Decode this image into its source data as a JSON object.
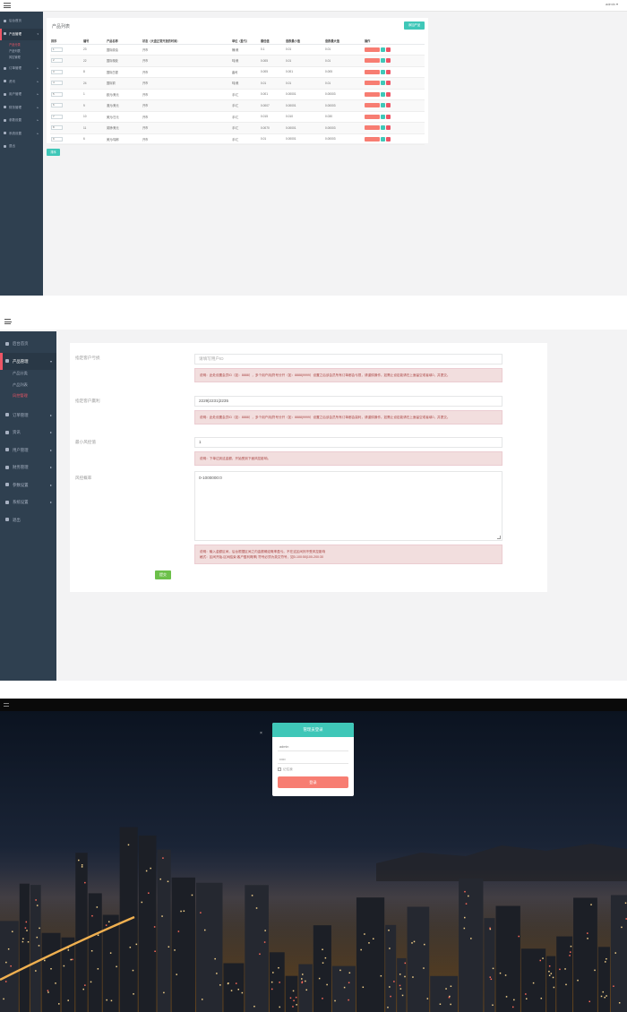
{
  "topbar": {
    "user": "admin ▾"
  },
  "screen1": {
    "sidebar": {
      "items": [
        {
          "label": "后台首页",
          "icon": "home-icon"
        },
        {
          "label": "产品管理",
          "icon": "product-icon",
          "active": true,
          "arrow": "▾"
        },
        {
          "label": "订单管理",
          "icon": "order-icon",
          "arrow": "▸"
        },
        {
          "label": "资讯",
          "icon": "news-icon",
          "arrow": "▸"
        },
        {
          "label": "用户管理",
          "icon": "user-icon",
          "arrow": "▸"
        },
        {
          "label": "财务管理",
          "icon": "finance-icon",
          "arrow": "▸"
        },
        {
          "label": "参数设置",
          "icon": "params-icon",
          "arrow": "▸"
        },
        {
          "label": "系统设置",
          "icon": "system-icon",
          "arrow": "▸"
        },
        {
          "label": "退出",
          "icon": "logout-icon"
        }
      ],
      "subitems": [
        {
          "label": "产品分类",
          "current": true
        },
        {
          "label": "产品列表"
        },
        {
          "label": "风控管理"
        }
      ]
    },
    "panel_title": "产品列表",
    "add_button": "添加产品",
    "table": {
      "headers": [
        "排序",
        "编号",
        "产品名称",
        "状态（大盘正常开放的时间）",
        "单位（盈亏）",
        "最低值",
        "涨跌最小值",
        "涨跌最大值",
        "操作"
      ],
      "rows": [
        {
          "order": "1",
          "id": "23",
          "name": "国际原油",
          "status": "开市",
          "unit": "桶/美",
          "min": "0.1",
          "step_min": "0.01",
          "step_max": "0.01"
        },
        {
          "order": "2",
          "id": "22",
          "name": "国际橡胶",
          "status": "开市",
          "unit": "吨/美",
          "min": "0.005",
          "step_min": "0.01",
          "step_max": "0.01"
        },
        {
          "order": "3",
          "id": "8",
          "name": "国际白银",
          "status": "开市",
          "unit": "盎司",
          "min": "0.005",
          "step_min": "0.001",
          "step_max": "0.005"
        },
        {
          "order": "4",
          "id": "24",
          "name": "国际铜",
          "status": "开市",
          "unit": "吨/美",
          "min": "0.01",
          "step_min": "0.01",
          "step_max": "0.01"
        },
        {
          "order": "5",
          "id": "1",
          "name": "欧元/美元",
          "status": "开市",
          "unit": "手/汇",
          "min": "0.001",
          "step_min": "0.00001",
          "step_max": "0.00003"
        },
        {
          "order": "6",
          "id": "9",
          "name": "澳元/美元",
          "status": "开市",
          "unit": "手/汇",
          "min": "0.0007",
          "step_min": "0.00001",
          "step_max": "0.00003"
        },
        {
          "order": "7",
          "id": "10",
          "name": "美元/日元",
          "status": "开市",
          "unit": "手/汇",
          "min": "0.015",
          "step_min": "0.010",
          "step_max": "0.030"
        },
        {
          "order": "8",
          "id": "11",
          "name": "英镑/美元",
          "status": "开市",
          "unit": "手/汇",
          "min": "0.0070",
          "step_min": "0.00001",
          "step_max": "0.00003"
        },
        {
          "order": "9",
          "id": "6",
          "name": "美元/瑞郎",
          "status": "开市",
          "unit": "手/汇",
          "min": "0.01",
          "step_min": "0.00001",
          "step_max": "0.00003"
        }
      ],
      "ops": {
        "set": "风控设置",
        "edit": "✎",
        "del": "✕"
      }
    },
    "sort_button": "排序"
  },
  "screen2": {
    "sidebar": {
      "items": [
        {
          "label": "后台首页",
          "icon": "home-icon"
        },
        {
          "label": "产品管理",
          "icon": "product-icon",
          "active": true,
          "arrow": "▾"
        },
        {
          "label": "订单管理",
          "icon": "order-icon",
          "arrow": "▸"
        },
        {
          "label": "资讯",
          "icon": "news-icon",
          "arrow": "▸"
        },
        {
          "label": "用户管理",
          "icon": "user-icon",
          "arrow": "▸"
        },
        {
          "label": "财务管理",
          "icon": "finance-icon",
          "arrow": "▸"
        },
        {
          "label": "参数设置",
          "icon": "params-icon",
          "arrow": "▸"
        },
        {
          "label": "系统设置",
          "icon": "system-icon",
          "arrow": "▸"
        },
        {
          "label": "退出",
          "icon": "logout-icon"
        }
      ],
      "subitems": [
        {
          "label": "产品分类"
        },
        {
          "label": "产品列表"
        },
        {
          "label": "风控管理",
          "current": true
        }
      ]
    },
    "form": {
      "field1_label": "指定客户亏损",
      "field1_placeholder": "请填写用户ID",
      "alert1": "说明：此处设置会员ID（如：8888），多个用户用|符号分开（如：8888|9999）设置之后该会员所有订单都会亏损，请谨慎操作。如需止设定能请在上面留空或者填0，并提交。",
      "field2_label": "指定客户赢利",
      "field2_value": "2229|2231|2235",
      "alert2": "说明：此处设置会员ID（如：8888），多个用户用|符号分开（如：8888|9999）设置之后该会员所有订单都会赢利，请谨慎操作。如需止设定能请在上面留空或者填0，并提交。",
      "field3_label": "最小风控值",
      "field3_value": "1",
      "alert3": "说明：下单达到这金额，开始受到下面风控影响。",
      "field4_label": "风控概率",
      "field4_value": "0-1000000:0",
      "alert4": "说明：输入金额区间，后台根据区间之内金额确定概率盈亏。不在这区间则不受风控影响\n格式：区间开始-区间结束:客户盈利概率|  符号必须为英文符号，如0-100:50|100-200:30",
      "submit": "提交"
    }
  },
  "screen3": {
    "login": {
      "title": "管理员登录",
      "username": "admin",
      "password": "•••••",
      "remember": "记住我",
      "button": "登录"
    },
    "close": "×"
  }
}
